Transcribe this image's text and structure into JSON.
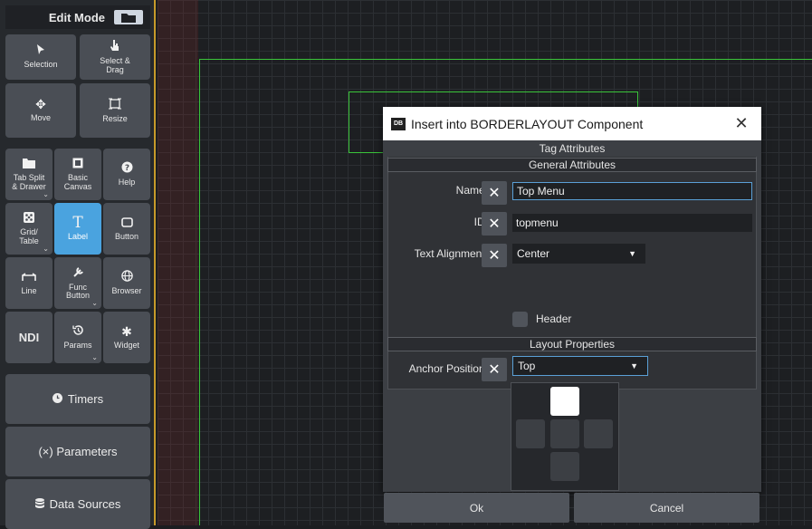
{
  "sidebar": {
    "edit_mode_label": "Edit Mode",
    "tools": {
      "selection": "Selection",
      "select_drag": "Select & Drag",
      "move": "Move",
      "resize": "Resize",
      "tab_split_drawer": "Tab Split & Drawer",
      "basic_canvas": "Basic Canvas",
      "help": "Help",
      "grid_table": "Grid/ Table",
      "label": "Label",
      "button": "Button",
      "line": "Line",
      "func_button": "Func Button",
      "browser": "Browser",
      "ndi": "NDI",
      "params": "Params",
      "widget": "Widget"
    },
    "timers": "Timers",
    "parameters": "(×) Parameters",
    "data_sources": "Data Sources"
  },
  "dialog": {
    "title": "Insert into BORDERLAYOUT Component",
    "close_glyph": "✕",
    "app_icon_text": "DB",
    "tag_attributes_heading": "Tag Attributes",
    "general_attributes_heading": "General Attributes",
    "layout_properties_heading": "Layout Properties",
    "fields": {
      "name_label": "Name:",
      "name_value": "Top Menu",
      "id_label": "ID:",
      "id_value": "topmenu",
      "text_alignment_label": "Text Alignment:",
      "text_alignment_value": "Center",
      "header_label": "Header",
      "header_checked": false,
      "anchor_position_label": "Anchor Position:",
      "anchor_position_value": "Top"
    },
    "anchor_grid_selected": "top",
    "ok_label": "Ok",
    "cancel_label": "Cancel"
  },
  "colors": {
    "accent_blue": "#4aa3df",
    "layout_outline": "#3ac43a",
    "sidebar_border": "#c79a2a"
  }
}
